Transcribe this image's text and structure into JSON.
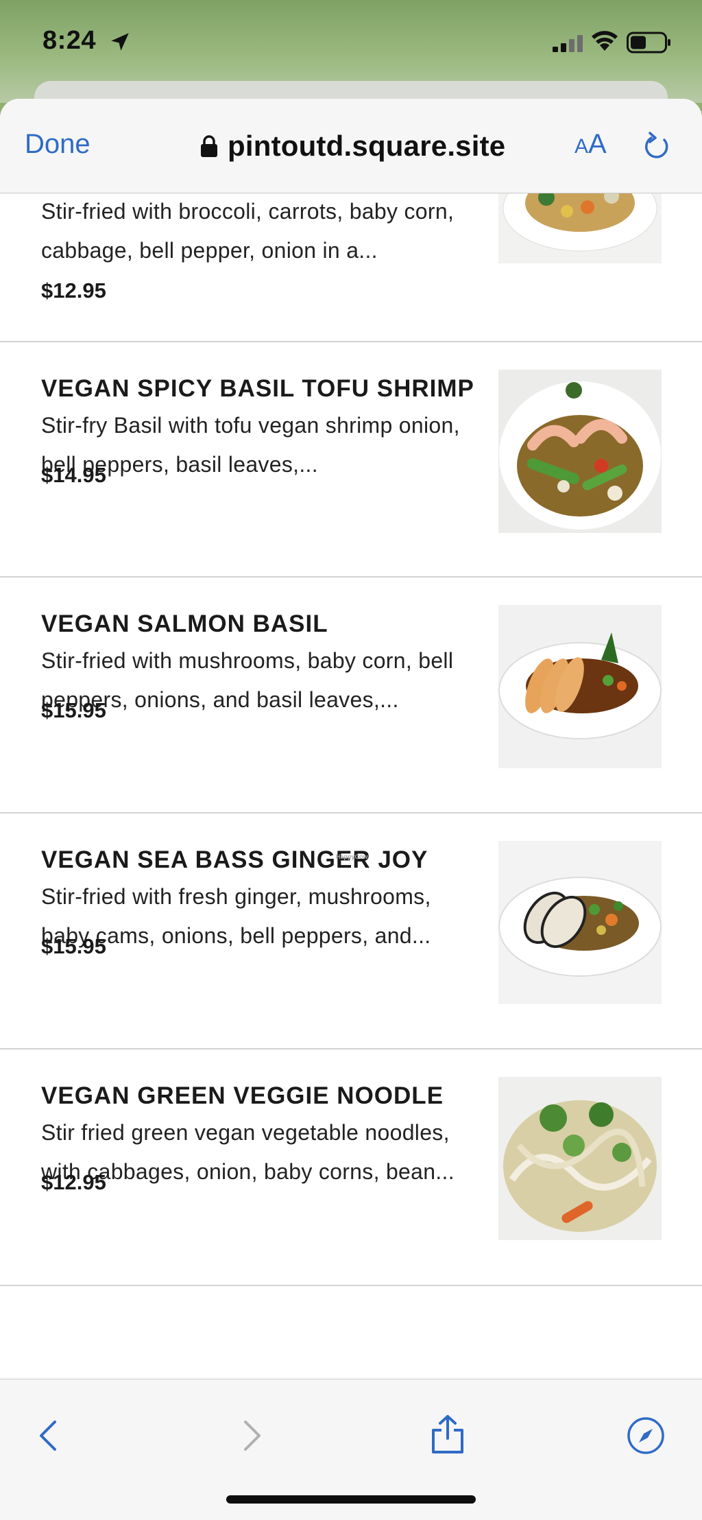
{
  "status_bar": {
    "time": "8:24",
    "location_icon": "location-arrow-icon",
    "signal_icon": "cellular-signal-icon",
    "wifi_icon": "wifi-icon",
    "battery_icon": "battery-icon"
  },
  "browser": {
    "done_label": "Done",
    "url": "pintoutd.square.site",
    "text_size_small": "A",
    "text_size_large": "A",
    "accent_color": "#2f6bc7"
  },
  "menu": {
    "partial_item": {
      "description": "Stir-fried with broccoli, carrots, baby corn, cabbage, bell pepper, onion in a...",
      "price": "$12.95"
    },
    "items": [
      {
        "title": "VEGAN SPICY BASIL TOFU SHRIMP",
        "description": "Stir-fry Basil with tofu vegan shrimp onion, bell peppers, basil leaves,...",
        "price": "$14.95"
      },
      {
        "title": "VEGAN SALMON BASIL",
        "description": "Stir-fried with mushrooms, baby corn, bell peppers, onions, and basil leaves,...",
        "price": "$15.95"
      },
      {
        "title": "VEGAN SEA BASS GINGER JOY",
        "description": "Stir-fried with fresh ginger, mushrooms, baby cams, onions, bell peppers, and...",
        "price": "$15.95"
      },
      {
        "title": "VEGAN GREEN VEGGIE NOODLE",
        "description": "Stir fried green vegan vegetable noodles, with cabbages, onion, baby corns, bean...",
        "price": "$12.95"
      }
    ],
    "watermark": "HappyCow"
  },
  "toolbar": {
    "back_icon": "chevron-left-icon",
    "forward_icon": "chevron-right-icon",
    "share_icon": "share-icon",
    "safari_icon": "compass-icon"
  }
}
